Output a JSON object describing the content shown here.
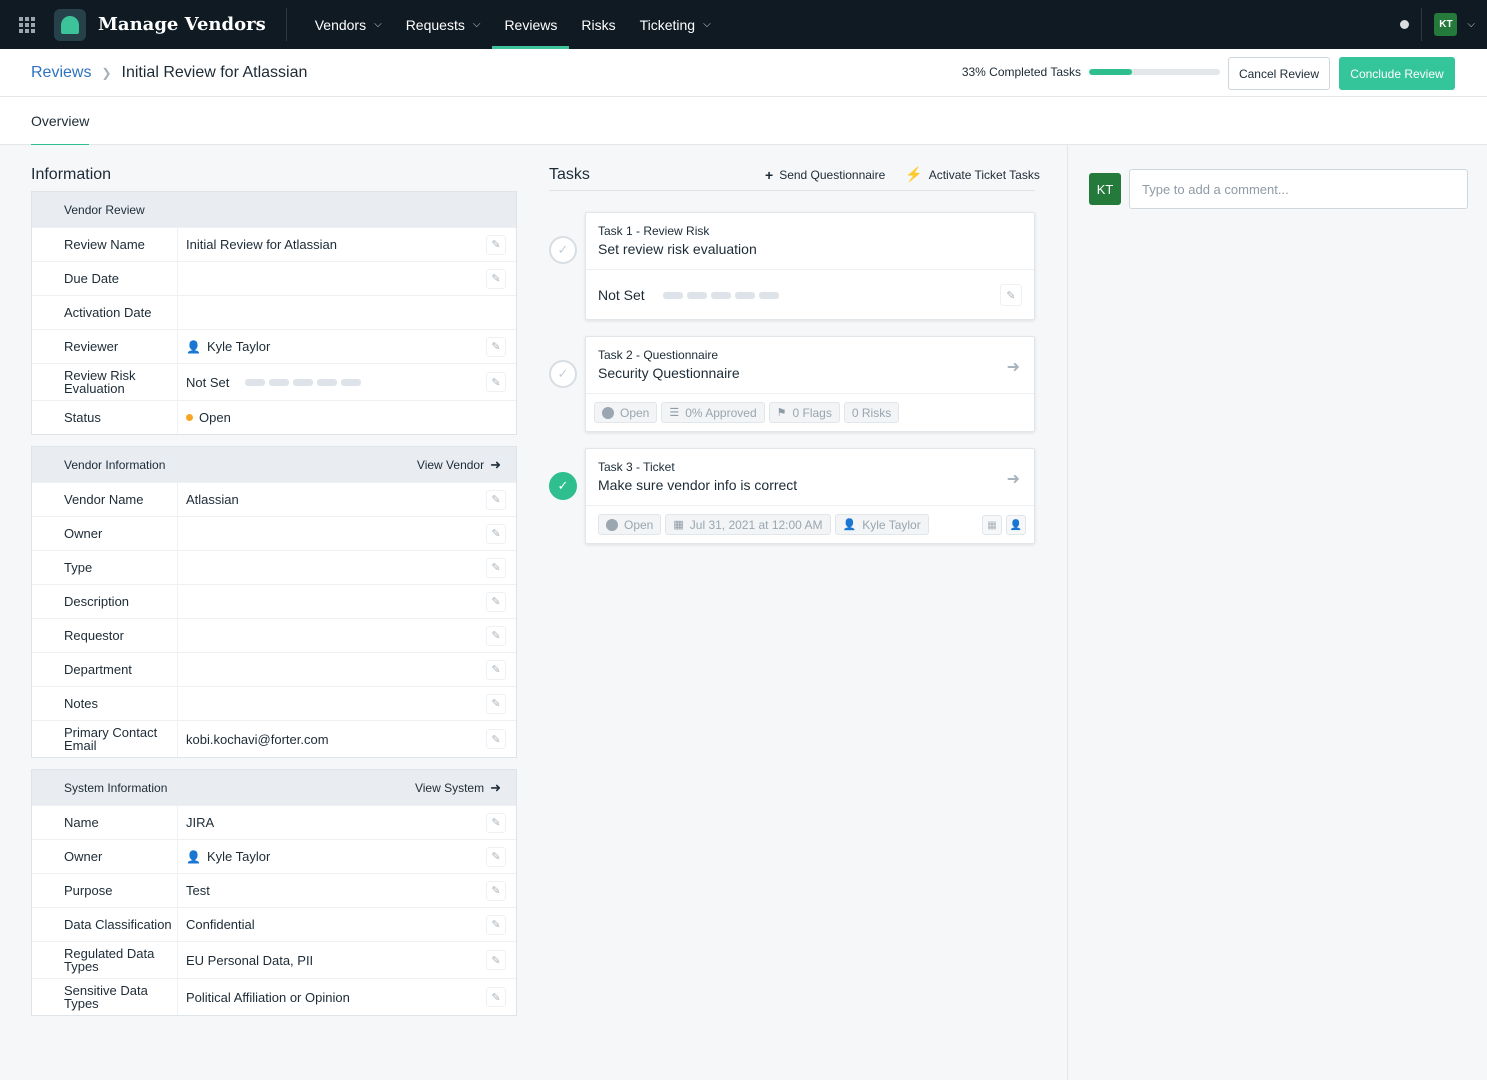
{
  "app": {
    "name": "Manage Vendors"
  },
  "nav": [
    {
      "label": "Vendors",
      "dropdown": true
    },
    {
      "label": "Requests",
      "dropdown": true
    },
    {
      "label": "Reviews",
      "dropdown": false,
      "active": true
    },
    {
      "label": "Risks",
      "dropdown": false
    },
    {
      "label": "Ticketing",
      "dropdown": true
    }
  ],
  "user": {
    "initials": "KT"
  },
  "breadcrumb": {
    "parent": "Reviews",
    "current": "Initial Review for Atlassian"
  },
  "progress": {
    "label": "33% Completed Tasks",
    "percent": 33
  },
  "buttons": {
    "cancel": "Cancel Review",
    "conclude": "Conclude Review"
  },
  "tabs": {
    "overview": "Overview"
  },
  "information": {
    "title": "Information",
    "vendor_review": {
      "title": "Vendor Review",
      "rows": [
        {
          "label": "Review Name",
          "value": "Initial Review for Atlassian"
        },
        {
          "label": "Due Date",
          "value": ""
        },
        {
          "label": "Activation Date",
          "value": ""
        },
        {
          "label": "Reviewer",
          "value": "Kyle Taylor"
        },
        {
          "label": "Review Risk Evaluation",
          "value": "Not Set"
        },
        {
          "label": "Status",
          "value": "Open"
        }
      ]
    },
    "vendor_information": {
      "title": "Vendor Information",
      "link": "View Vendor",
      "rows": [
        {
          "label": "Vendor Name",
          "value": "Atlassian"
        },
        {
          "label": "Owner",
          "value": ""
        },
        {
          "label": "Type",
          "value": ""
        },
        {
          "label": "Description",
          "value": ""
        },
        {
          "label": "Requestor",
          "value": ""
        },
        {
          "label": "Department",
          "value": ""
        },
        {
          "label": "Notes",
          "value": ""
        },
        {
          "label": "Primary Contact Email",
          "value": "kobi.kochavi@forter.com"
        }
      ]
    },
    "system_information": {
      "title": "System Information",
      "link": "View System",
      "rows": [
        {
          "label": "Name",
          "value": "JIRA"
        },
        {
          "label": "Owner",
          "value": "Kyle Taylor"
        },
        {
          "label": "Purpose",
          "value": "Test"
        },
        {
          "label": "Data Classification",
          "value": "Confidential"
        },
        {
          "label": "Regulated Data Types",
          "value": "EU Personal Data, PII"
        },
        {
          "label": "Sensitive Data Types",
          "value": "Political Affiliation or Opinion"
        }
      ]
    }
  },
  "tasks": {
    "title": "Tasks",
    "actions": {
      "send_questionnaire": "Send Questionnaire",
      "activate_ticket_tasks": "Activate Ticket Tasks"
    },
    "items": [
      {
        "kind": "Task 1 - Review Risk",
        "name": "Set review risk evaluation",
        "status_text": "Not Set",
        "completed": false
      },
      {
        "kind": "Task 2 - Questionnaire",
        "name": "Security Questionnaire",
        "chips": {
          "status": "Open",
          "approved": "0% Approved",
          "flags": "0 Flags",
          "risks": "0 Risks"
        },
        "completed": false
      },
      {
        "kind": "Task 3 - Ticket",
        "name": "Make sure vendor info is correct",
        "chips": {
          "status": "Open",
          "date": "Jul 31, 2021 at 12:00 AM",
          "assignee": "Kyle Taylor"
        },
        "completed": true
      }
    ]
  },
  "comments": {
    "avatar": "KT",
    "placeholder": "Type to add a comment..."
  },
  "colors": {
    "accent": "#35c59a",
    "link": "#2e73c0",
    "topbar": "#0f1a22",
    "status_open": "#f5a623"
  }
}
